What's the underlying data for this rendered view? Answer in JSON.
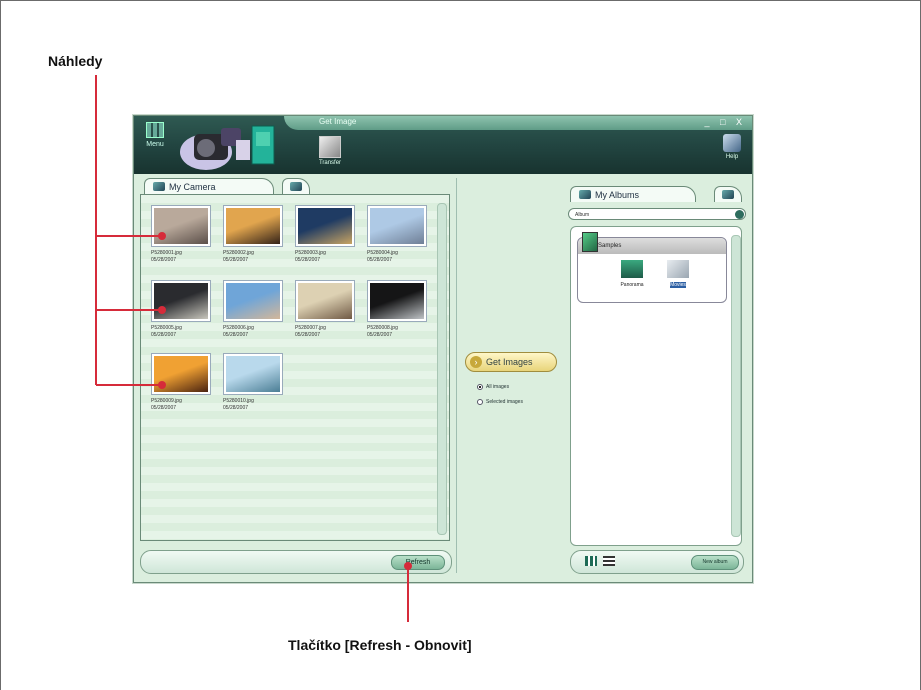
{
  "callouts": {
    "previews_label": "Náhledy",
    "refresh_label": "Tlačítko [Refresh - Obnovit]"
  },
  "window": {
    "title": "Get Image",
    "window_buttons": "_ □ X",
    "menu_label": "Menu",
    "transfer_label": "Transfer",
    "help_label": "Help"
  },
  "left": {
    "tab_label": "My Camera",
    "refresh_button": "Refresh",
    "thumbnails": [
      {
        "name": "P5280001.jpg",
        "date": "05/28/2007",
        "colors": [
          "#b9a99b",
          "#5b4f49"
        ]
      },
      {
        "name": "P5280002.jpg",
        "date": "05/28/2007",
        "colors": [
          "#e1a54e",
          "#332218"
        ]
      },
      {
        "name": "P5280003.jpg",
        "date": "05/28/2007",
        "colors": [
          "#1f3b63",
          "#c8a463"
        ]
      },
      {
        "name": "P5280004.jpg",
        "date": "05/28/2007",
        "colors": [
          "#aec9e5",
          "#6f7f96"
        ]
      },
      {
        "name": "P5280005.jpg",
        "date": "05/28/2007",
        "colors": [
          "#2a2b2f",
          "#c9c7bd"
        ]
      },
      {
        "name": "P5280006.jpg",
        "date": "05/28/2007",
        "colors": [
          "#6fa5d8",
          "#d3b79a"
        ]
      },
      {
        "name": "P5280007.jpg",
        "date": "05/28/2007",
        "colors": [
          "#ddd1b3",
          "#705a45"
        ]
      },
      {
        "name": "P5280008.jpg",
        "date": "05/28/2007",
        "colors": [
          "#151516",
          "#bfc3c6"
        ]
      },
      {
        "name": "P5280009.jpg",
        "date": "05/28/2007",
        "colors": [
          "#f0a133",
          "#4a2310"
        ]
      },
      {
        "name": "P5280010.jpg",
        "date": "05/28/2007",
        "colors": [
          "#b9d9ec",
          "#4b7e95"
        ]
      }
    ]
  },
  "center": {
    "get_images_button": "Get Images",
    "radio_all": "All images",
    "radio_selected": "Selected images"
  },
  "right": {
    "tab_label": "My Albums",
    "album_select_value": "Album",
    "group_label": "Samples",
    "album_items": [
      {
        "label": "Panorama",
        "selected": false
      },
      {
        "label": "Movies",
        "selected": true
      }
    ],
    "new_album_button": "New album"
  },
  "colors": {
    "callout_line": "#d62b3a",
    "titlebar": "#224541",
    "panel_bg": "#dbeede"
  }
}
